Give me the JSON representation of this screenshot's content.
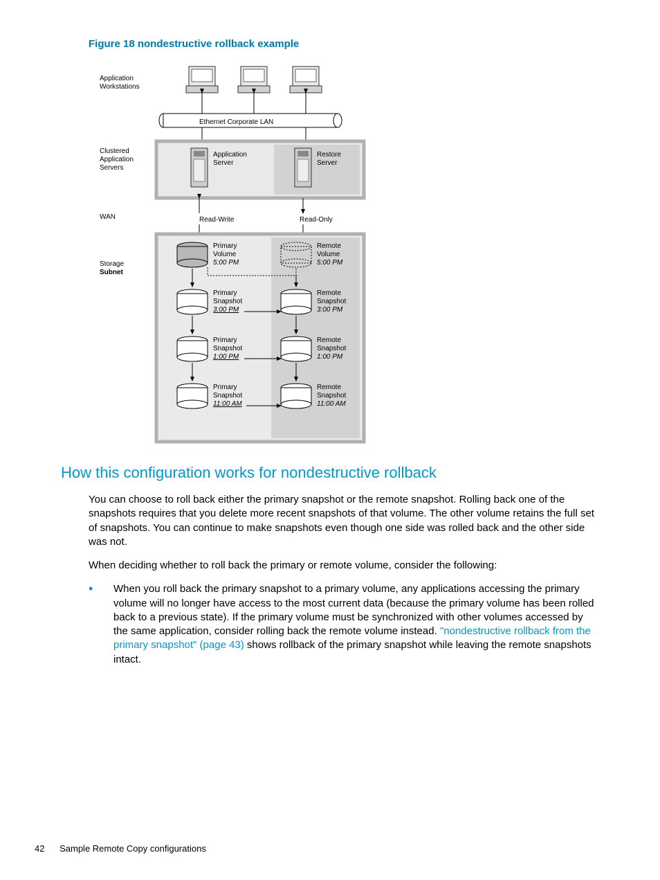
{
  "figure": {
    "caption": "Figure 18 nondestructive rollback example"
  },
  "diagram": {
    "labels": {
      "app_workstations_l1": "Application",
      "app_workstations_l2": "Workstations",
      "ethernet_lan": "Ethernet Corporate LAN",
      "clustered_l1": "Clustered",
      "clustered_l2": "Application",
      "clustered_l3": "Servers",
      "app_server_l1": "Application",
      "app_server_l2": "Server",
      "restore_l1": "Restore",
      "restore_l2": "Server",
      "wan": "WAN",
      "read_write": "Read-Write",
      "read_only": "Read-Only",
      "storage": "Storage",
      "subnet": "Subnet",
      "pv_l1": "Primary",
      "pv_l2": "Volume",
      "pv_t": "5:00 PM",
      "rv_l1": "Remote",
      "rv_l2": "Volume",
      "rv_t": "5:00 PM",
      "ps1_l1": "Primary",
      "ps1_l2": "Snapshot",
      "ps1_t": "3:00 PM",
      "rs1_l1": "Remote",
      "rs1_l2": "Snapshot",
      "rs1_t": "3:00 PM",
      "ps2_l1": "Primary",
      "ps2_l2": "Snapshot",
      "ps2_t": "1:00 PM",
      "rs2_l1": "Remote",
      "rs2_l2": "Snapshot",
      "rs2_t": "1:00 PM",
      "ps3_l1": "Primary",
      "ps3_l2": "Snapshot",
      "ps3_t": "11:00 AM",
      "rs3_l1": "Remote",
      "rs3_l2": "Snapshot",
      "rs3_t": "11:00 AM"
    }
  },
  "section": {
    "heading": "How this configuration works for nondestructive rollback"
  },
  "paras": {
    "p1": "You can choose to roll back either the primary snapshot or the remote snapshot. Rolling back one of the snapshots requires that you delete more recent snapshots of that volume. The other volume retains the full set of snapshots. You can continue to make snapshots even though one side was rolled back and the other side was not.",
    "p2": "When deciding whether to roll back the primary or remote volume, consider the following:"
  },
  "bullets": {
    "b1_pre": "When you roll back the primary snapshot to a primary volume, any applications accessing the primary volume will no longer have access to the most current data (because the primary volume has been rolled back to a previous state). If the primary volume must be synchronized with other volumes accessed by the same application, consider rolling back the remote volume instead. ",
    "b1_link": "\"nondestructive rollback from the primary snapshot\" (page 43)",
    "b1_post": " shows rollback of the primary snapshot while leaving the remote snapshots intact."
  },
  "footer": {
    "page": "42",
    "title": "Sample Remote Copy configurations"
  }
}
